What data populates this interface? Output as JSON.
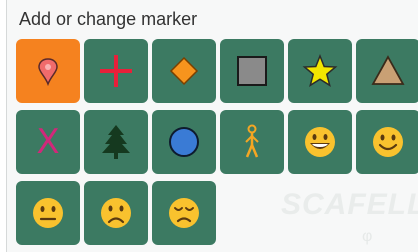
{
  "title": "Add or change marker",
  "background_text": {
    "watermark": "SCAFELL",
    "sub_text": "φ"
  },
  "markers": [
    {
      "name": "pin",
      "icon": "pin-icon",
      "selected": true
    },
    {
      "name": "cross",
      "icon": "plus-icon"
    },
    {
      "name": "diamond",
      "icon": "diamond-icon"
    },
    {
      "name": "square",
      "icon": "square-icon"
    },
    {
      "name": "star",
      "icon": "star-icon"
    },
    {
      "name": "triangle",
      "icon": "triangle-icon"
    },
    {
      "name": "x",
      "icon": "x-icon",
      "glyph": "X"
    },
    {
      "name": "tree",
      "icon": "tree-icon"
    },
    {
      "name": "circle",
      "icon": "circle-icon"
    },
    {
      "name": "walker",
      "icon": "walker-icon"
    },
    {
      "name": "grin",
      "icon": "grinning-face-icon"
    },
    {
      "name": "smile",
      "icon": "smiling-face-icon"
    },
    {
      "name": "neutral",
      "icon": "neutral-face-icon"
    },
    {
      "name": "frown",
      "icon": "frowning-face-icon"
    },
    {
      "name": "sad",
      "icon": "sad-face-icon"
    }
  ],
  "colors": {
    "tile": "#3c7a62",
    "selected": "#f5821f",
    "pin": "#f06b6b",
    "cross": "#e8203a",
    "diamond": "#f7941d",
    "square": "#8a8a8a",
    "star": "#f2e600",
    "triangle": "#c9a074",
    "x": "#d1287a",
    "tree": "#15391f",
    "circle": "#3a7bd5",
    "walker": "#f5a623",
    "face": "#f9c22e"
  }
}
